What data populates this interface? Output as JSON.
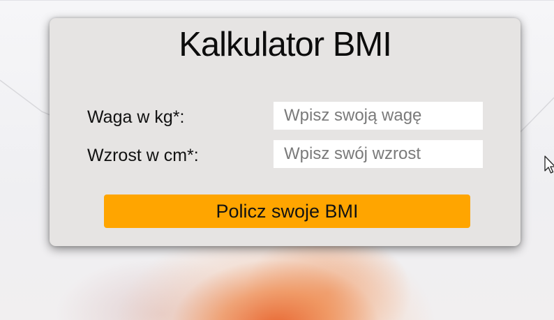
{
  "calculator": {
    "title": "Kalkulator BMI",
    "weight_label": "Waga w kg*:",
    "weight_placeholder": "Wpisz swoją wagę",
    "weight_value": "",
    "height_label": "Wzrost w cm*:",
    "height_placeholder": "Wpisz swój wzrost",
    "height_value": "",
    "submit_label": "Policz swoje BMI"
  },
  "colors": {
    "card_background": "#e6e4e3",
    "button_accent": "#ffa500",
    "background_glow": "#e86028"
  },
  "icons": {
    "cursor": "mouse-pointer-icon"
  }
}
